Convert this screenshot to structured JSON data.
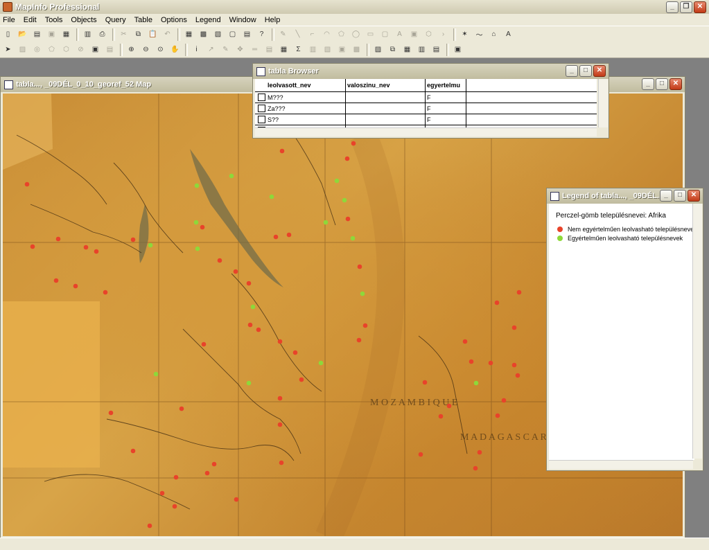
{
  "app": {
    "title": "MapInfo Professional"
  },
  "menu": [
    "File",
    "Edit",
    "Tools",
    "Objects",
    "Query",
    "Table",
    "Options",
    "Legend",
    "Window",
    "Help"
  ],
  "map_window": {
    "title": "tabla..., _09DÉL_0_10_georef_52 Map"
  },
  "browser": {
    "title": "tabla Browser",
    "columns": [
      "leolvasott_nev",
      "valoszinu_nev",
      "egyertelmu"
    ],
    "rows": [
      {
        "leolvasott_nev": "M???",
        "valoszinu_nev": "",
        "egyertelmu": "F"
      },
      {
        "leolvasott_nev": "Za???",
        "valoszinu_nev": "",
        "egyertelmu": "F"
      },
      {
        "leolvasott_nev": "S??",
        "valoszinu_nev": "",
        "egyertelmu": "F"
      },
      {
        "leolvasott_nev": "???",
        "valoszinu_nev": "",
        "egyertelmu": "F"
      }
    ]
  },
  "legend": {
    "window_title": "Legend of tabla..., _09DÉL...",
    "title": "Perczel-gömb településnevei: Afrika",
    "items": [
      {
        "label": "Nem egyértelműen leolvasható településnevek",
        "color": "#e8432a"
      },
      {
        "label": "Egyértelműen leolvasható településnevek",
        "color": "#8ed83a"
      }
    ]
  },
  "colors": {
    "red_point": "#e8432a",
    "green_point": "#8ed83a"
  }
}
